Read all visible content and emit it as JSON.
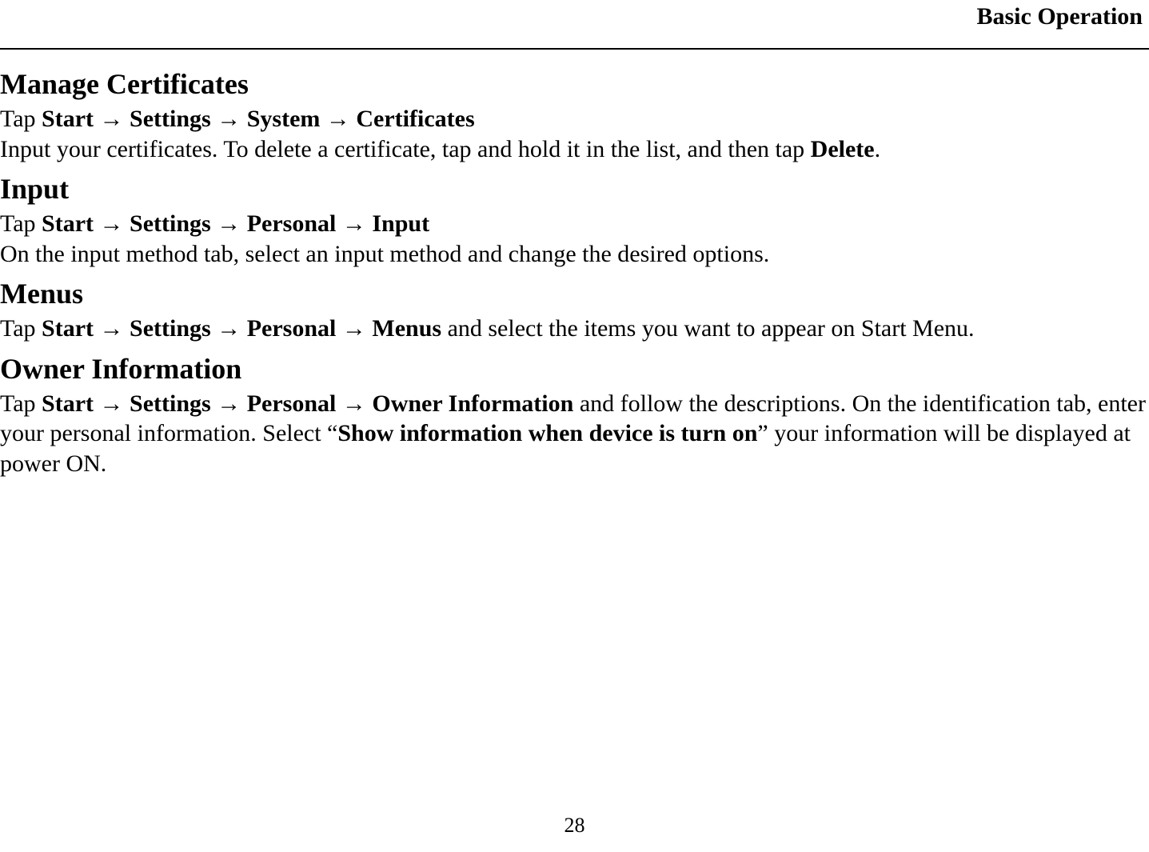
{
  "header": {
    "title": "Basic Operation"
  },
  "arrow": "→",
  "sections": {
    "certificates": {
      "heading": "Manage Certificates",
      "tap": "Tap ",
      "path": [
        "Start",
        "Settings",
        "System",
        "Certificates"
      ],
      "body_pre": "Input your certificates. To delete a certificate, tap and hold it in the list, and then tap ",
      "delete_word": "Delete",
      "body_post": "."
    },
    "input": {
      "heading": "Input",
      "tap": "Tap ",
      "path": [
        "Start",
        "Settings",
        "Personal",
        "Input"
      ],
      "body": "On the input method tab, select an input method and change the desired options."
    },
    "menus": {
      "heading": "Menus",
      "tap": "Tap ",
      "path": [
        "Start",
        "Settings",
        "Personal",
        "Menus"
      ],
      "tail": " and select the items you want to appear on Start Menu."
    },
    "owner": {
      "heading": "Owner Information",
      "tap": "Tap ",
      "path": [
        "Start",
        "Settings",
        "Personal",
        "Owner Information"
      ],
      "mid1": " and follow the descriptions. On the identification tab, enter your personal information. Select “",
      "show_bold": "Show information when device is turn on",
      "mid2": "” your information will be displayed at power ON."
    }
  },
  "page_number": "28"
}
